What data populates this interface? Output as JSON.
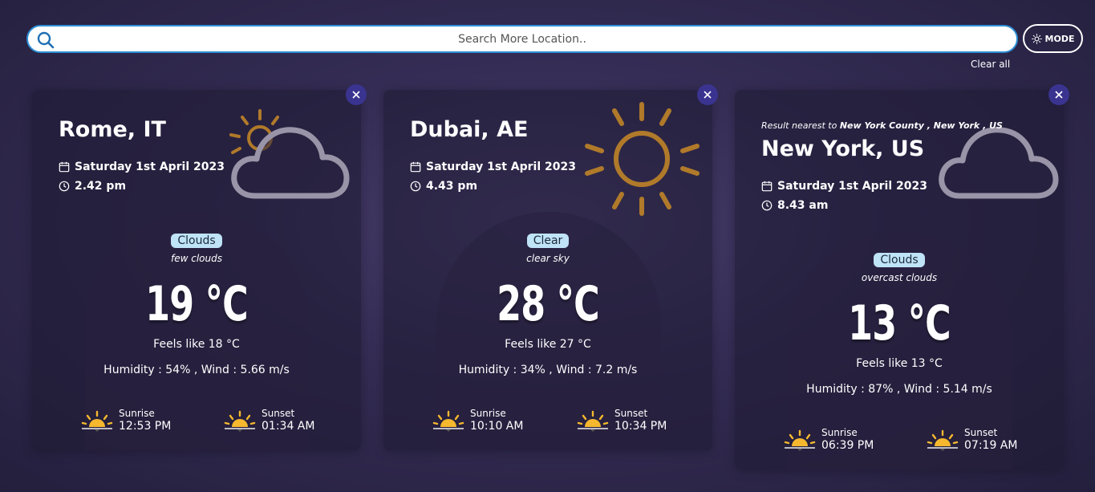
{
  "search": {
    "placeholder": "Search More Location.."
  },
  "mode_button": {
    "label": "MODE"
  },
  "clear_all": "Clear all",
  "cards": [
    {
      "city": "Rome, IT",
      "date": "Saturday 1st April 2023",
      "time": "2.42 pm",
      "condition": "Clouds",
      "description": "few clouds",
      "temp": "19 °C",
      "feels_like": "Feels like 18 °C",
      "humidity_wind": "Humidity : 54% , Wind : 5.66 m/s",
      "sunrise_label": "Sunrise",
      "sunrise_time": "12:53 PM",
      "sunset_label": "Sunset",
      "sunset_time": "01:34 AM",
      "icon": "sun-behind-cloud-icon"
    },
    {
      "city": "Dubai, AE",
      "date": "Saturday 1st April 2023",
      "time": "4.43 pm",
      "condition": "Clear",
      "description": "clear sky",
      "temp": "28 °C",
      "feels_like": "Feels like 27 °C",
      "humidity_wind": "Humidity : 34% , Wind : 7.2 m/s",
      "sunrise_label": "Sunrise",
      "sunrise_time": "10:10 AM",
      "sunset_label": "Sunset",
      "sunset_time": "10:34 PM",
      "icon": "sun-icon"
    },
    {
      "nearest_prefix": "Result nearest to",
      "nearest_place": "New York County , New York , US",
      "city": "New York, US",
      "date": "Saturday 1st April 2023",
      "time": "8.43 am",
      "condition": "Clouds",
      "description": "overcast clouds",
      "temp": "13 °C",
      "feels_like": "Feels like 13 °C",
      "humidity_wind": "Humidity : 87% , Wind : 5.14 m/s",
      "sunrise_label": "Sunrise",
      "sunrise_time": "06:39 PM",
      "sunset_label": "Sunset",
      "sunset_time": "07:19 AM",
      "icon": "cloud-icon"
    }
  ],
  "colors": {
    "badge_bg": "#bfe3f7",
    "close_btn": "#3a3490",
    "search_border": "#2e8fd6",
    "sun_icon": "#b07a2a",
    "cloud_icon": "#9a94a8",
    "sunrise_icon": "#f5b82e"
  }
}
